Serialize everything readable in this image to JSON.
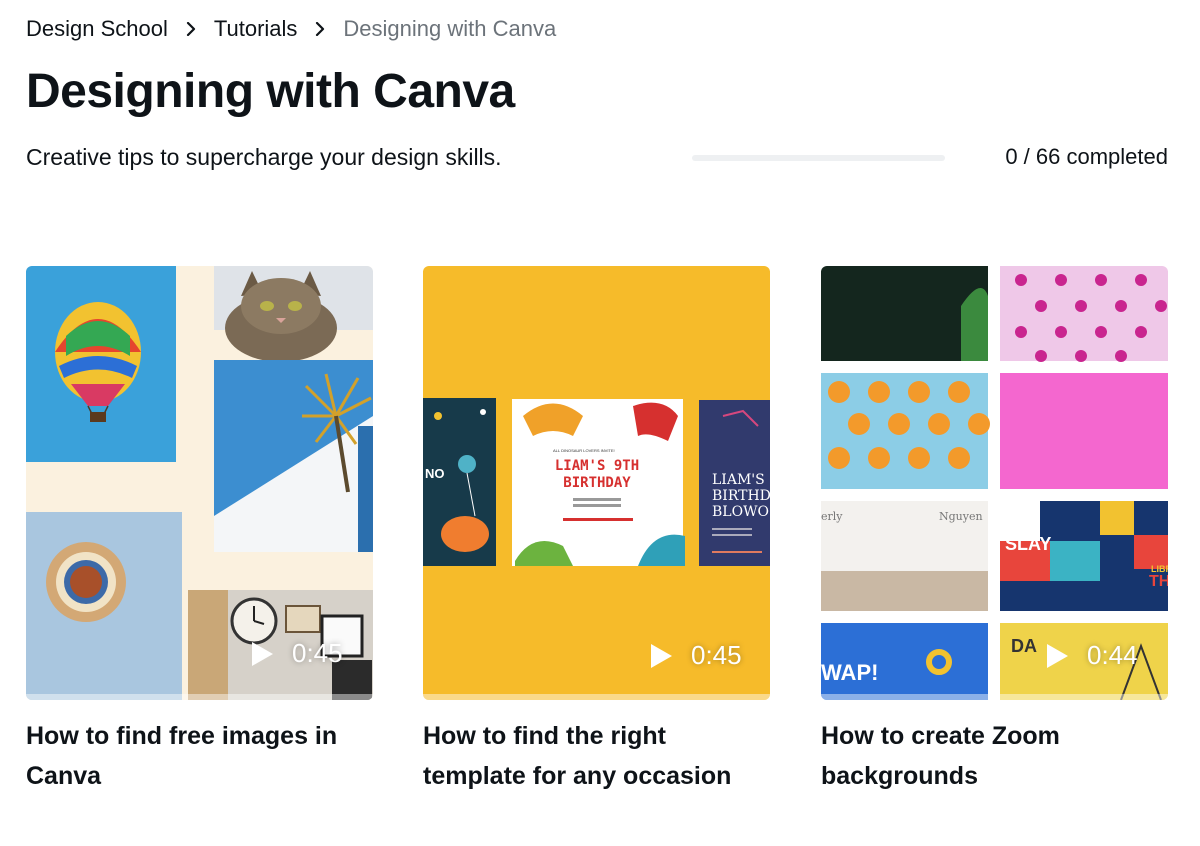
{
  "breadcrumb": {
    "items": [
      "Design School",
      "Tutorials"
    ],
    "current": "Designing with Canva"
  },
  "page": {
    "title": "Designing with Canva",
    "subtitle": "Creative tips to supercharge your design skills.",
    "progress_text": "0 / 66 completed",
    "progress_fraction": 0
  },
  "cards": [
    {
      "title": "How to find free images in Canva",
      "duration": "0:45",
      "thumb_text": []
    },
    {
      "title": "How to find the right template for any occasion",
      "duration": "0:45",
      "thumb_text": [
        "ALL DINOSAUR LOVERS INVITE!",
        "LIAM'S 9TH",
        "BIRTHDAY",
        "LIAM'S",
        "BIRTHD",
        "BLOWO",
        "NO"
      ]
    },
    {
      "title": "How to create Zoom backgrounds",
      "duration": "0:44",
      "thumb_text": [
        "erly",
        "Nguyen",
        "SLAY",
        "LIBRA",
        "THE",
        "DA",
        "WAP!"
      ]
    }
  ],
  "colors": {
    "accent": "#7d2ae8",
    "text": "#0e1318",
    "muted": "#6c737a",
    "template_bg": "#f6bb2a"
  },
  "icons": {
    "separator": "chevron-right-icon",
    "play": "play-icon"
  }
}
